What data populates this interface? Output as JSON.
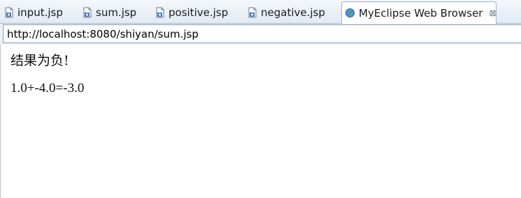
{
  "tabs": [
    {
      "label": "input.jsp",
      "icon": "jsp-file-icon"
    },
    {
      "label": "sum.jsp",
      "icon": "jsp-file-icon"
    },
    {
      "label": "positive.jsp",
      "icon": "jsp-file-icon"
    },
    {
      "label": "negative.jsp",
      "icon": "jsp-file-icon"
    },
    {
      "label": "MyEclipse Web Browser",
      "icon": "globe-icon",
      "close_glyph": "⊠",
      "active": true
    }
  ],
  "address_bar": {
    "url": "http://localhost:8080/shiyan/sum.jsp"
  },
  "page": {
    "result_text": "结果为负!",
    "equation_text": "1.0+-4.0=-3.0"
  },
  "colors": {
    "tabbar_bg": "#e3eaf3",
    "border": "#7f9db9",
    "text": "#111111"
  }
}
